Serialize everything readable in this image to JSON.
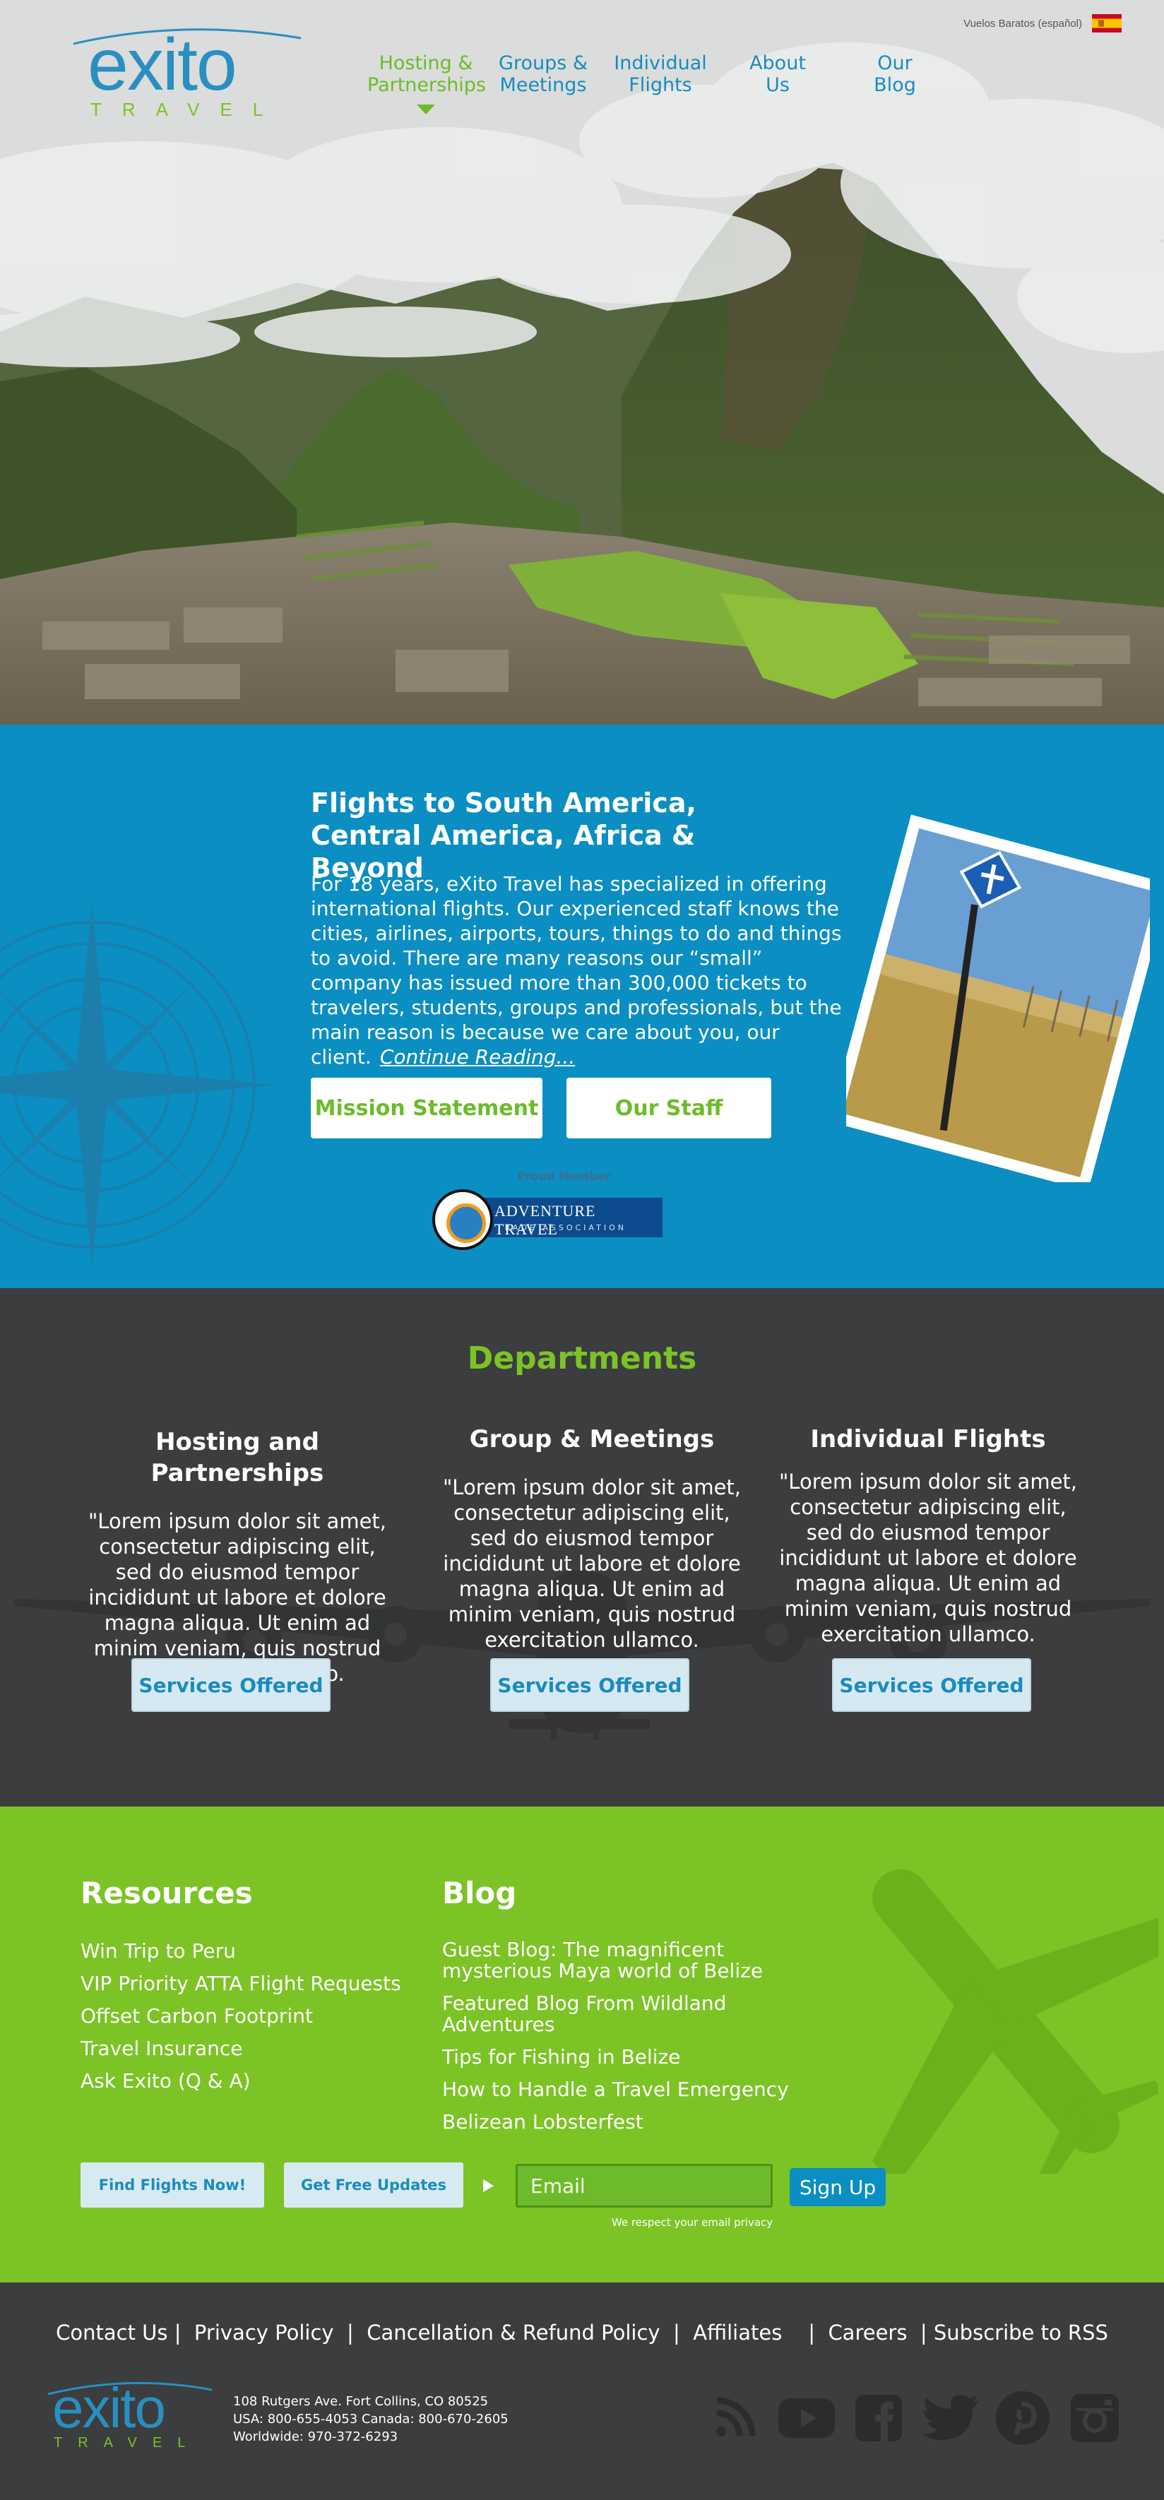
{
  "header": {
    "lang_link": "Vuelos Baratos (español)",
    "logo_word": "exito",
    "logo_sub": "TRAVEL",
    "nav": [
      {
        "line1": "Hosting &",
        "line2": "Partnerships"
      },
      {
        "line1": "Groups &",
        "line2": "Meetings"
      },
      {
        "line1": "Individual",
        "line2": "Flights"
      },
      {
        "line1": "About",
        "line2": "Us"
      },
      {
        "line1": "Our",
        "line2": "Blog"
      }
    ]
  },
  "intro": {
    "title": "Flights to South America, Central America, Africa & Beyond",
    "body": "For 18 years, eXito Travel has specialized in offering international flights. Our experienced staff knows the cities, airlines, airports, tours, things to do and things to avoid. There are many reasons our “small” company has issued more than 300,000 tickets to travelers, students, groups and professionals, but the main reason is because we care about you, our client.",
    "continue_link": "Continue Reading...",
    "mission_button": "Mission Statement",
    "staff_button": "Our Staff",
    "atta_proud": "Proud Member",
    "atta_name": "ADVENTURE TRAVEL",
    "atta_sub": "TRADE ASSOCIATION"
  },
  "departments": {
    "title": "Departments",
    "items": [
      {
        "title": "Hosting and Partnerships",
        "text": "\"Lorem ipsum dolor sit amet, consectetur adipiscing elit, sed do eiusmod tempor incididunt ut labore et dolore magna aliqua. Ut enim ad minim veniam, quis nostrud exercitation ullamco.",
        "button": "Services Offered"
      },
      {
        "title": "Group & Meetings",
        "text": "\"Lorem ipsum dolor sit amet, consectetur adipiscing elit, sed do eiusmod tempor incididunt ut labore et dolore magna aliqua. Ut enim ad minim veniam, quis nostrud exercitation ullamco.",
        "button": "Services Offered"
      },
      {
        "title": "Individual Flights",
        "text": "\"Lorem ipsum dolor sit amet, consectetur adipiscing elit, sed do eiusmod tempor incididunt ut labore et dolore magna aliqua. Ut enim ad minim veniam, quis nostrud exercitation ullamco.",
        "button": "Services Offered"
      }
    ]
  },
  "resources": {
    "title": "Resources",
    "links": [
      "Win Trip to Peru",
      "VIP Priority ATTA Flight Requests",
      "Offset Carbon Footprint",
      "Travel Insurance",
      "Ask Exito (Q & A)"
    ]
  },
  "blog": {
    "title": "Blog",
    "links": [
      "Guest Blog: The magnificent mysterious Maya world of Belize",
      "Featured Blog From Wildland Adventures",
      "Tips for Fishing in Belize",
      "How to Handle a Travel Emergency",
      "Belizean Lobsterfest"
    ]
  },
  "signup": {
    "find_button": "Find Flights Now!",
    "updates_button": "Get Free Updates",
    "email_placeholder": "Email",
    "signup_button": "Sign Up",
    "privacy_note": "We respect your email privacy"
  },
  "footer": {
    "links": [
      "Contact Us |",
      "Privacy Policy",
      "|",
      "Cancellation & Refund Policy",
      "|",
      "Affiliates",
      "|",
      "Careers",
      "| Subscribe to RSS"
    ],
    "address": [
      "108 Rutgers Ave. Fort Collins, CO 80525",
      "USA: 800-655-4053 Canada: 800-670-2605",
      "Worldwide: 970-372-6293"
    ],
    "social_icons": [
      "rss-icon",
      "youtube-icon",
      "facebook-icon",
      "twitter-icon",
      "pinterest-icon",
      "instagram-icon"
    ]
  },
  "colors": {
    "brand_blue": "#0b8ec2",
    "brand_green": "#7cc325",
    "dark": "#3b3d3f"
  }
}
